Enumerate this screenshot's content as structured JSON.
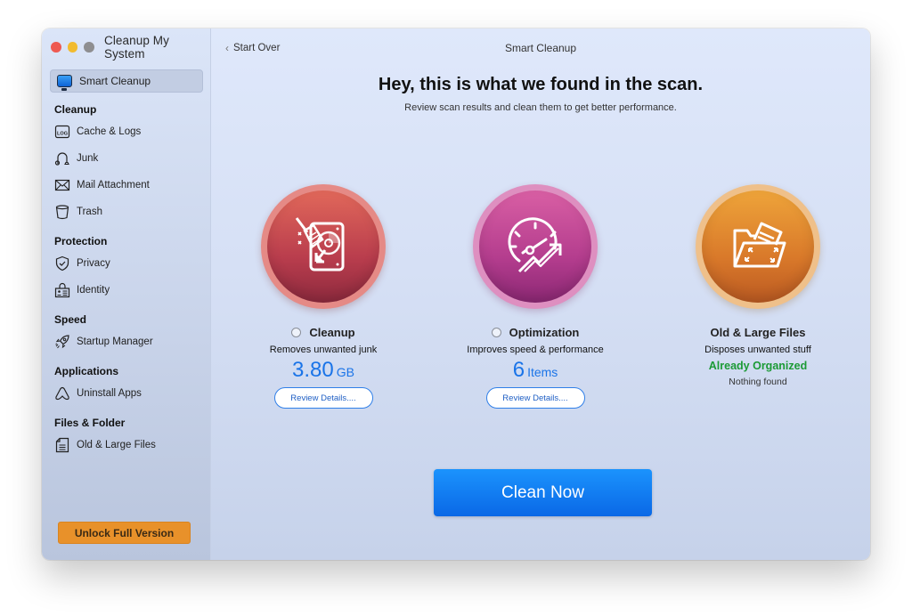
{
  "window": {
    "app_title": "Cleanup My System"
  },
  "sidebar": {
    "selected": {
      "label": "Smart Cleanup",
      "icon": "monitor-icon"
    },
    "sections": [
      {
        "title": "Cleanup",
        "items": [
          {
            "label": "Cache & Logs",
            "icon": "log-file-icon"
          },
          {
            "label": "Junk",
            "icon": "vacuum-icon"
          },
          {
            "label": "Mail Attachment",
            "icon": "mail-icon"
          },
          {
            "label": "Trash",
            "icon": "trash-icon"
          }
        ]
      },
      {
        "title": "Protection",
        "items": [
          {
            "label": "Privacy",
            "icon": "shield-check-icon"
          },
          {
            "label": "Identity",
            "icon": "id-card-icon"
          }
        ]
      },
      {
        "title": "Speed",
        "items": [
          {
            "label": "Startup Manager",
            "icon": "rocket-icon"
          }
        ]
      },
      {
        "title": "Applications",
        "items": [
          {
            "label": "Uninstall Apps",
            "icon": "app-store-icon"
          }
        ]
      },
      {
        "title": "Files & Folder",
        "items": [
          {
            "label": "Old & Large Files",
            "icon": "document-icon"
          }
        ]
      }
    ],
    "unlock_label": "Unlock Full Version",
    "unlock_color": "#e8912a"
  },
  "main": {
    "back_label": "Start Over",
    "title": "Smart Cleanup",
    "headline": "Hey, this is what we found in the scan.",
    "subheadline": "Review scan results and clean them to get better performance.",
    "cards": [
      {
        "title": "Cleanup",
        "icon": "hard-drive-broom-icon",
        "has_radio": true,
        "description": "Removes unwanted junk",
        "value": "3.80",
        "unit": "GB",
        "button_label": "Review Details...."
      },
      {
        "title": "Optimization",
        "icon": "speedometer-trend-icon",
        "has_radio": true,
        "description": "Improves speed & performance",
        "value": "6",
        "unit": "Items",
        "button_label": "Review Details...."
      },
      {
        "title": "Old & Large Files",
        "icon": "folder-expand-icon",
        "has_radio": false,
        "description": "Disposes unwanted stuff",
        "status": "Already Organized",
        "note": "Nothing found"
      }
    ],
    "primary_button_label": "Clean Now",
    "accent_color": "#1a74e8",
    "success_color": "#1b9a35"
  }
}
